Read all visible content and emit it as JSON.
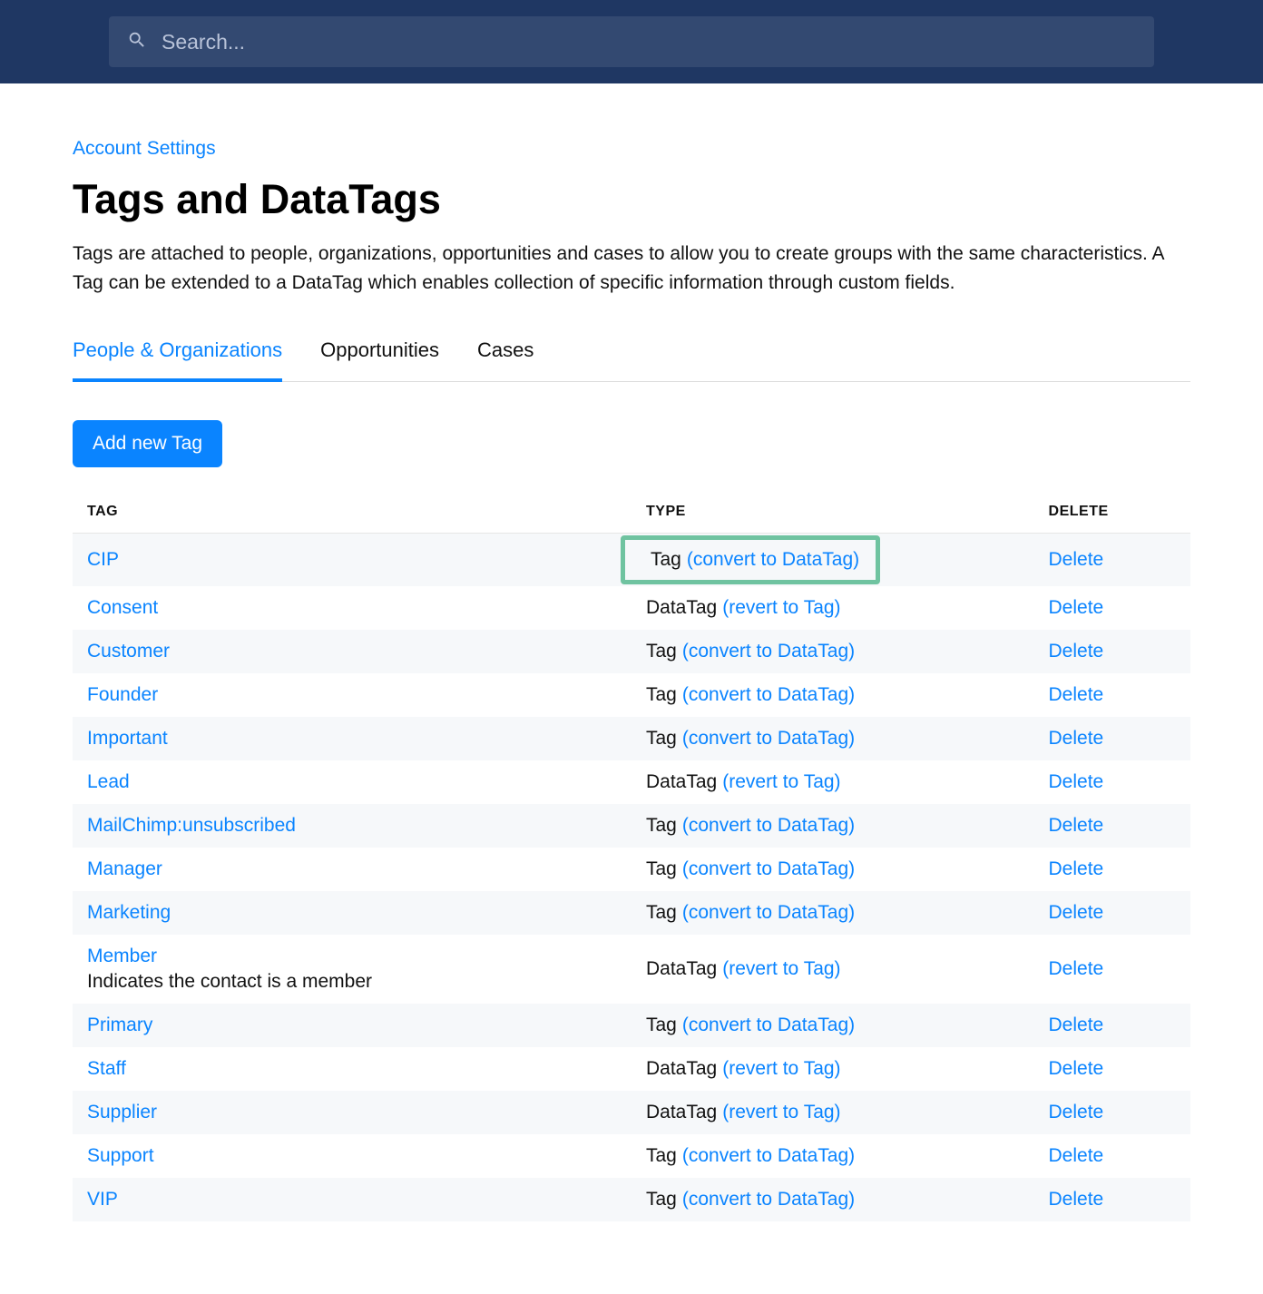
{
  "search": {
    "placeholder": "Search..."
  },
  "breadcrumb": "Account Settings",
  "title": "Tags and DataTags",
  "description": "Tags are attached to people, organizations, opportunities and cases to allow you to create groups with the same characteristics. A Tag can be extended to a DataTag which enables collection of specific information through custom fields.",
  "tabs": [
    {
      "label": "People & Organizations",
      "active": true
    },
    {
      "label": "Opportunities",
      "active": false
    },
    {
      "label": "Cases",
      "active": false
    }
  ],
  "add_button_label": "Add new Tag",
  "table": {
    "headers": {
      "tag": "TAG",
      "type": "TYPE",
      "delete": "DELETE"
    },
    "convert_label": "(convert to DataTag)",
    "revert_label": "(revert to Tag)",
    "delete_label": "Delete",
    "type_tag": "Tag",
    "type_datatag": "DataTag",
    "rows": [
      {
        "tag": "CIP",
        "type": "Tag",
        "highlight": true
      },
      {
        "tag": "Consent",
        "type": "DataTag"
      },
      {
        "tag": "Customer",
        "type": "Tag"
      },
      {
        "tag": "Founder",
        "type": "Tag"
      },
      {
        "tag": "Important",
        "type": "Tag"
      },
      {
        "tag": "Lead",
        "type": "DataTag"
      },
      {
        "tag": "MailChimp:unsubscribed",
        "type": "Tag"
      },
      {
        "tag": "Manager",
        "type": "Tag"
      },
      {
        "tag": "Marketing",
        "type": "Tag"
      },
      {
        "tag": "Member",
        "type": "DataTag",
        "subtext": "Indicates the contact is a member"
      },
      {
        "tag": "Primary",
        "type": "Tag"
      },
      {
        "tag": "Staff",
        "type": "DataTag"
      },
      {
        "tag": "Supplier",
        "type": "DataTag"
      },
      {
        "tag": "Support",
        "type": "Tag"
      },
      {
        "tag": "VIP",
        "type": "Tag"
      }
    ]
  }
}
